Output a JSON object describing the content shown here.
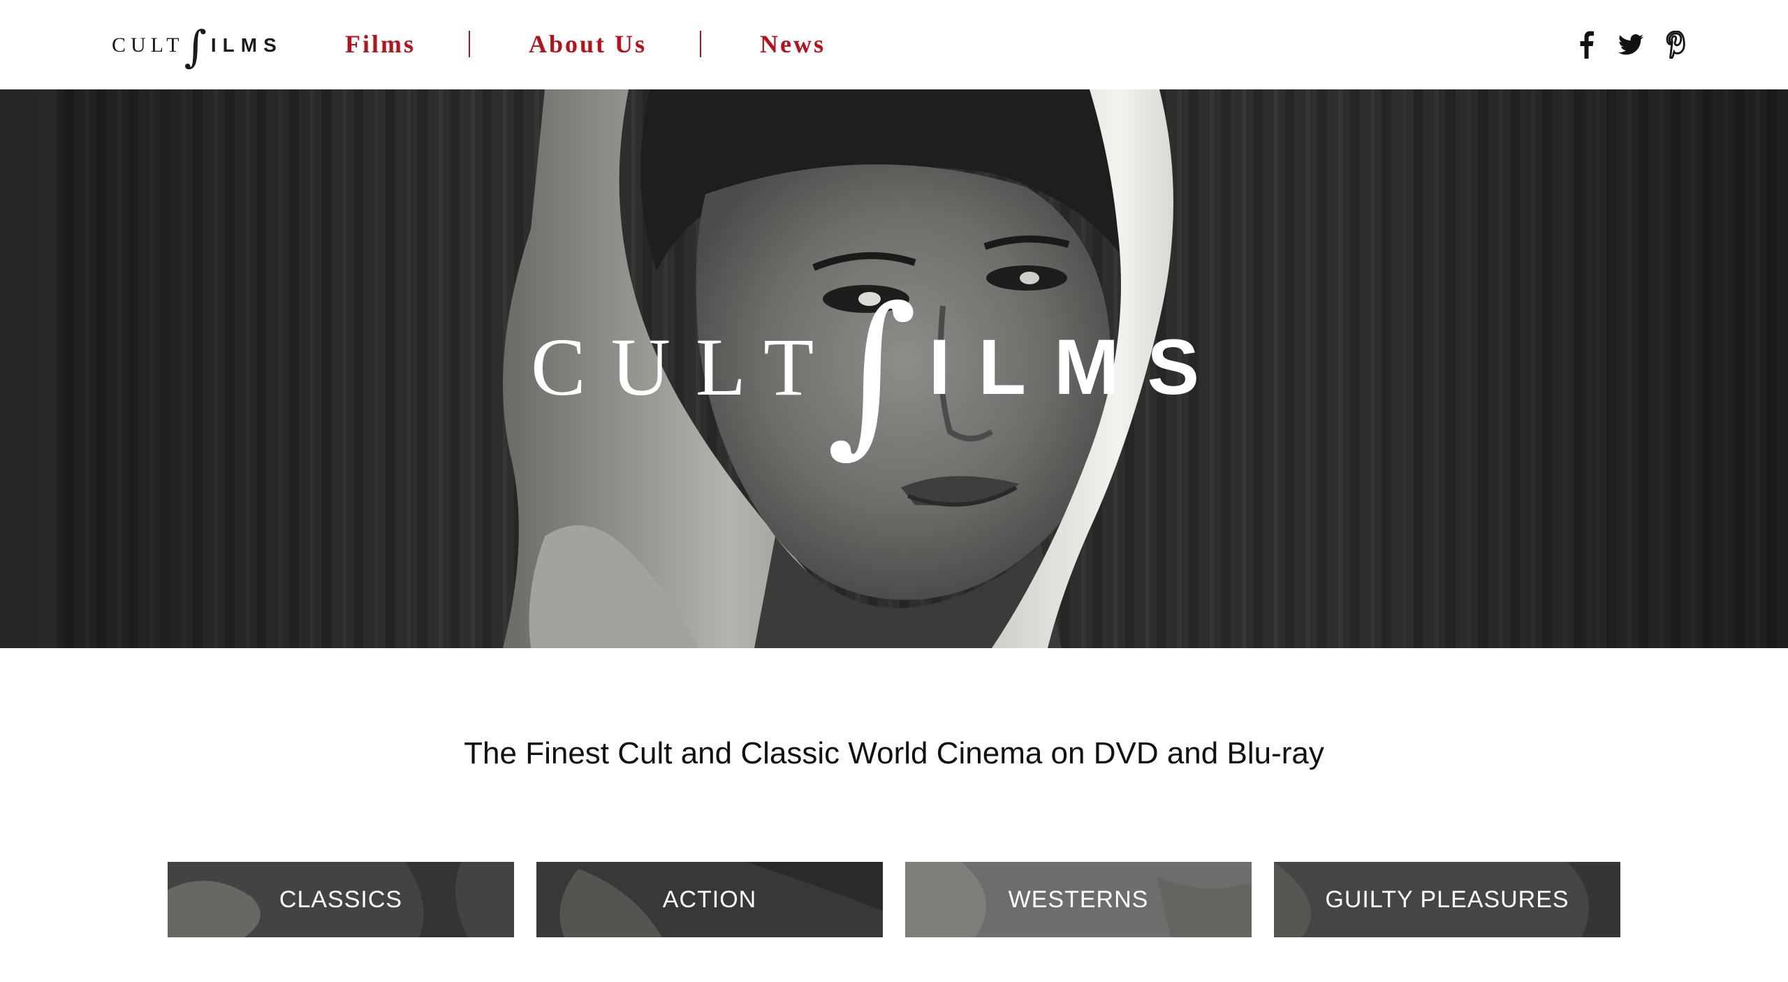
{
  "brand": {
    "logo_cult": "CULT",
    "logo_integral": "∫",
    "logo_ilms": "ILMS"
  },
  "nav": {
    "items": [
      {
        "label": "Films"
      },
      {
        "label": "About Us"
      },
      {
        "label": "News"
      }
    ]
  },
  "social": {
    "icons": [
      "facebook-icon",
      "twitter-icon",
      "pinterest-icon"
    ]
  },
  "hero": {
    "logo_cult": "CULT",
    "logo_integral": "∫",
    "logo_ilms": "ILMS"
  },
  "tagline": "The Finest Cult and Classic World Cinema on DVD and Blu-ray",
  "categories": [
    {
      "label": "CLASSICS"
    },
    {
      "label": "ACTION"
    },
    {
      "label": "WESTERNS"
    },
    {
      "label": "GUILTY PLEASURES"
    }
  ],
  "colors": {
    "accent": "#b5121b",
    "text": "#111111",
    "hero_bg": "#2b2b2a",
    "tile_overlay": "#4a4a4a"
  }
}
